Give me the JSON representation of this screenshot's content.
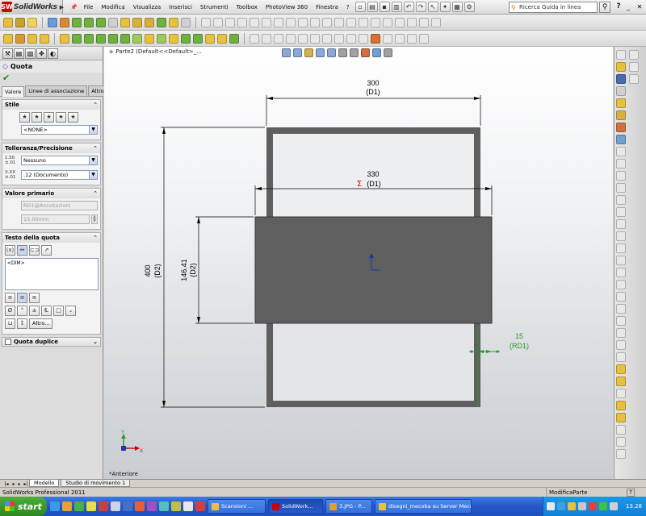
{
  "app": {
    "logo_letters": "SW",
    "name": "SolidWorks",
    "menus": [
      "File",
      "Modifica",
      "Visualizza",
      "Inserisci",
      "Strumenti",
      "Toolbox",
      "PhotoView 360",
      "Finestra",
      "?"
    ],
    "search_placeholder": "Ricerca Guida in linea",
    "help_label": "?"
  },
  "colors": {
    "dimension_red": "#cc0000",
    "selected_green": "#2a9a2a",
    "part_gray": "#5f5f5f",
    "origin_blue": "#1a3aa8"
  },
  "property_manager": {
    "title": "Quota",
    "tabs": [
      "Valore",
      "Linee di associazione",
      "Altro"
    ],
    "stile": {
      "title": "Stile",
      "selected": "<NONE>"
    },
    "tolleranza": {
      "title": "Tolleranza/Precisione",
      "tolerance_icon_label": "1.50 ±.01",
      "tolerance_value": "Nessuno",
      "precision_icon_label": "X.XX ±.01",
      "precision_value": ".12 (Documento)"
    },
    "valore_primario": {
      "title": "Valore primario",
      "name": "RD1@Annotazioni",
      "value": "15.00mm"
    },
    "testo_quota": {
      "title": "Testo della quota",
      "text": "<DIM>",
      "more_button": "Altro..."
    },
    "quota_duplice": {
      "title": "Quota duplice"
    }
  },
  "document": {
    "title": "Parte2 (Default<<Default>_...",
    "view_label": "*Anteriore"
  },
  "dimensions": [
    {
      "id": "d-300",
      "value": "300",
      "name": "(D1)"
    },
    {
      "id": "d-330",
      "value": "330",
      "symbol": "Σ",
      "name": "(D1)"
    },
    {
      "id": "d-400",
      "value": "400",
      "name": "(D2)"
    },
    {
      "id": "d-146",
      "value": "146.41",
      "name": "(D2)"
    },
    {
      "id": "d-15",
      "value": "15",
      "name": "(RD1)"
    }
  ],
  "triad": {
    "x": "X",
    "y": "Y"
  },
  "bottom_tabs": [
    "Modello",
    "Studio di movimento 1"
  ],
  "status": {
    "left": "SolidWorks Professional 2011",
    "right": "ModificaParte",
    "help": "?"
  },
  "taskbar": {
    "start": "start",
    "tasks": [
      {
        "label": "Scansioni ...",
        "active": false
      },
      {
        "label": "SolidWork...",
        "active": true
      },
      {
        "label": "3.JPG - P...",
        "active": false
      },
      {
        "label": "disegni_mecoba su Server Mecoba (Server",
        "active": false
      }
    ],
    "clock": "13.28"
  }
}
